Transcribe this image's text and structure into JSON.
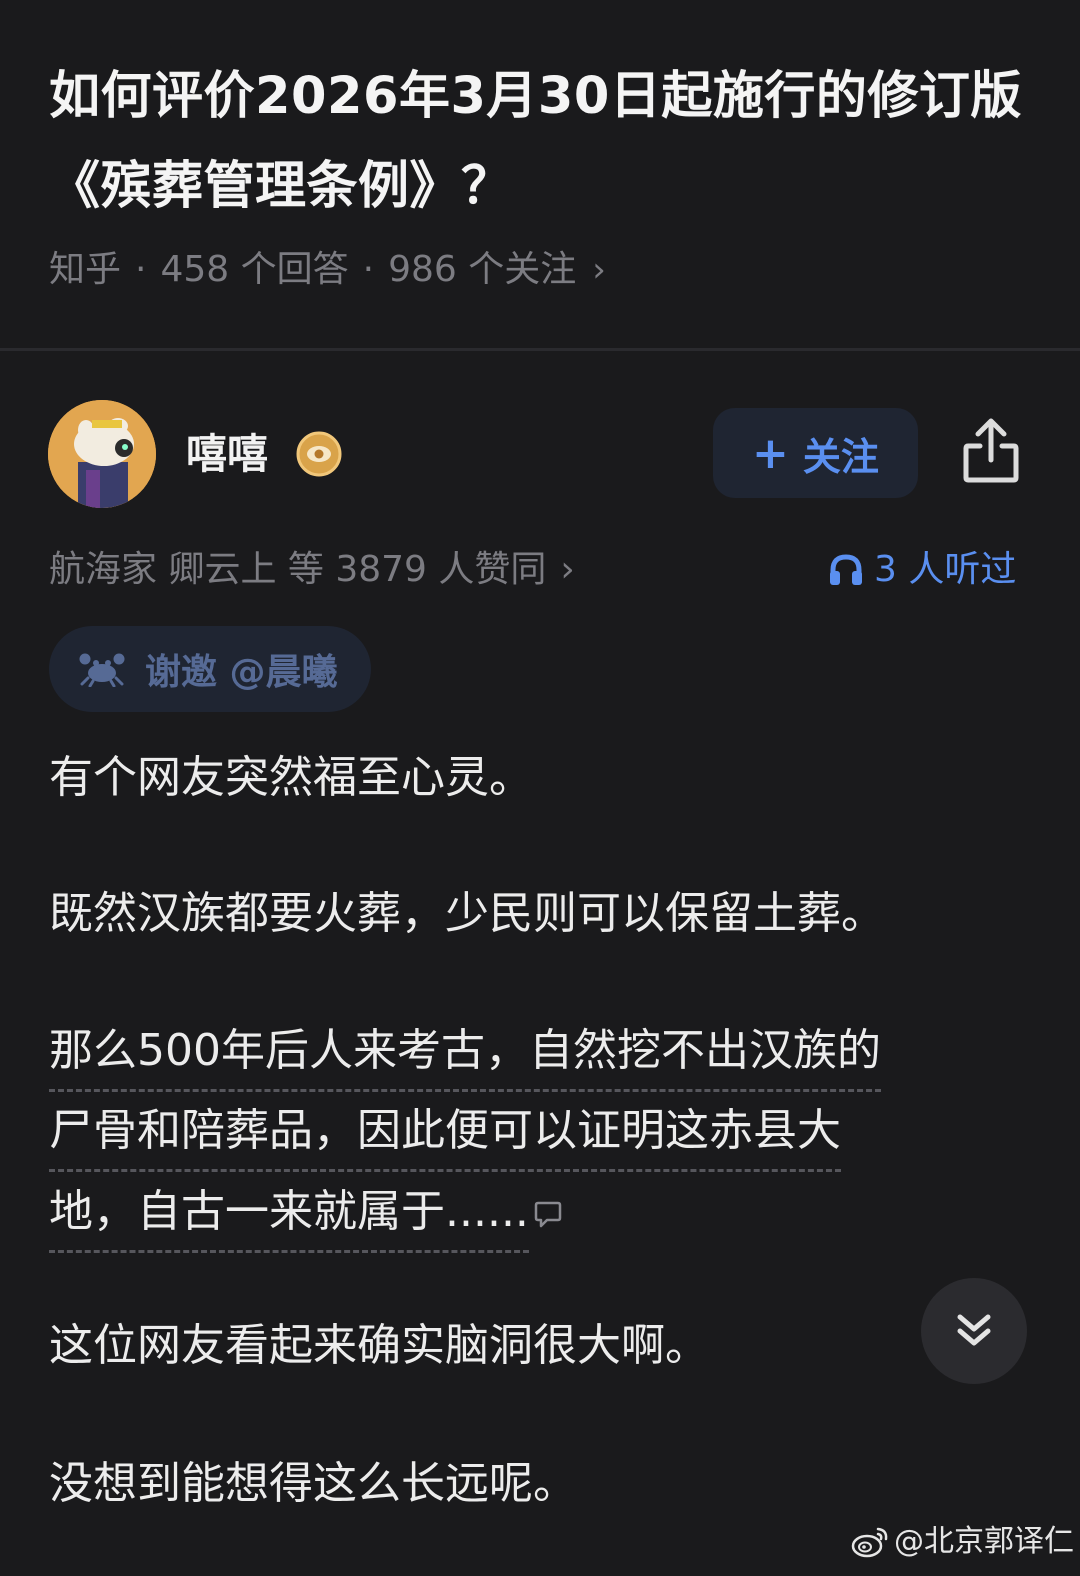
{
  "question": {
    "title": "如何评价2026年3月30日起施行的修订版《殡葬管理条例》？",
    "source": "知乎",
    "answers": "458 个回答",
    "followers": "986 个关注"
  },
  "author": {
    "name": "嘻嘻",
    "follow_label": "关注"
  },
  "answer_meta": {
    "upvote_text": "航海家 卿云上 等 3879 人赞同",
    "listened_text": "3 人听过",
    "invite_text": "谢邀 @晨曦"
  },
  "content": {
    "p1": "有个网友突然福至心灵。",
    "p2": "既然汉族都要火葬，少民则可以保留土葬。",
    "p3_lines": [
      "那么500年后人来考古，自然挖不出汉族的",
      "尸骨和陪葬品，因此便可以证明这赤县大",
      "地，自古一来就属于......"
    ],
    "p4": "这位网友看起来确实脑洞很大啊。",
    "p5": "没想到能想得这么长远呢。"
  },
  "watermark": "@北京郭译仁",
  "colors": {
    "background": "#1a1a1c",
    "accent_blue": "#5a8ff0",
    "muted_text": "#7c7c82",
    "button_bg": "#1f2532"
  },
  "icons": [
    "chevron-right-icon",
    "verified-badge-icon",
    "plus-icon",
    "share-icon",
    "headphones-icon",
    "crab-icon",
    "comment-icon",
    "double-chevron-down-icon",
    "weibo-icon"
  ]
}
